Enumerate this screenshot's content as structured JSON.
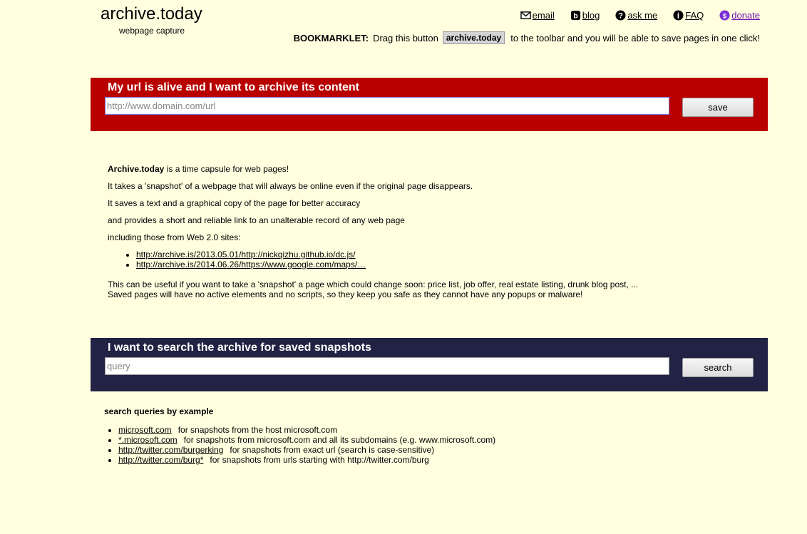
{
  "logo": {
    "title": "archive.today",
    "subtitle": "webpage capture"
  },
  "nav": {
    "email": "email",
    "blog": "blog",
    "ask": "ask me",
    "faq": "FAQ",
    "donate": "donate"
  },
  "bookmarklet": {
    "label": "BOOKMARKLET:",
    "pre": "Drag this button",
    "button": "archive.today",
    "post": "to the toolbar and you will be able to save pages in one click!"
  },
  "save_panel": {
    "title": "My url is alive and I want to archive its content",
    "placeholder": "http://www.domain.com/url",
    "button": "save"
  },
  "intro": {
    "brand": "Archive.today",
    "line1_rest": " is a time capsule for web pages!",
    "line2": "It takes a 'snapshot' of a webpage that will always be online even if the original page disappears.",
    "line3": "It saves a text and a graphical copy of the page for better accuracy",
    "line4": "and provides a short and reliable link to an unalterable record of any web page",
    "line5": "including those from Web 2.0 sites:",
    "links": [
      "http://archive.is/2013.05.01/http://nickqizhu.github.io/dc.js/",
      "http://archive.is/2014.06.26/https://www.google.com/maps/…"
    ],
    "useful": "This can be useful if you want to take a 'snapshot' a page which could change soon: price list, job offer, real estate listing, drunk blog post, ...",
    "safe": "Saved pages will have no active elements and no scripts, so they keep you safe as they cannot have any popups or malware!"
  },
  "search_panel": {
    "title": "I want to search the archive for saved snapshots",
    "placeholder": "query",
    "button": "search"
  },
  "examples": {
    "title": "search queries by example",
    "items": [
      {
        "query": "microsoft.com",
        "desc": "for snapshots from the host microsoft.com"
      },
      {
        "query": "*.microsoft.com",
        "desc": "for snapshots from microsoft.com and all its subdomains (e.g. www.microsoft.com)"
      },
      {
        "query": "http://twitter.com/burgerking",
        "desc": "for snapshots from exact url (search is case-sensitive)"
      },
      {
        "query": "http://twitter.com/burg*",
        "desc": "for snapshots from urls starting with http://twitter.com/burg"
      }
    ]
  },
  "colors": {
    "background": "#ffffe0",
    "save_panel": "#b80000",
    "search_panel": "#222244",
    "donate": "#6a0dad"
  }
}
